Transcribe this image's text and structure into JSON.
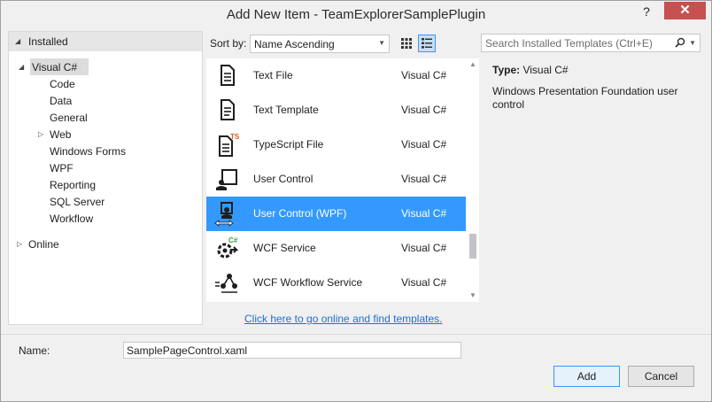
{
  "window": {
    "title": "Add New Item - TeamExplorerSamplePlugin",
    "help_glyph": "?",
    "close_glyph": "✕"
  },
  "sidebar": {
    "installed_label": "Installed",
    "visual_csharp_label": "Visual C#",
    "items": [
      {
        "label": "Code"
      },
      {
        "label": "Data"
      },
      {
        "label": "General"
      },
      {
        "label": "Web"
      },
      {
        "label": "Windows Forms"
      },
      {
        "label": "WPF"
      },
      {
        "label": "Reporting"
      },
      {
        "label": "SQL Server"
      },
      {
        "label": "Workflow"
      }
    ],
    "online_label": "Online"
  },
  "toolbar": {
    "sort_label": "Sort by:",
    "sort_value": "Name Ascending",
    "search_placeholder": "Search Installed Templates (Ctrl+E)"
  },
  "templates": [
    {
      "name": "Text File",
      "language": "Visual C#",
      "icon": "text-file-icon"
    },
    {
      "name": "Text Template",
      "language": "Visual C#",
      "icon": "text-template-icon"
    },
    {
      "name": "TypeScript File",
      "language": "Visual C#",
      "icon": "typescript-file-icon"
    },
    {
      "name": "User Control",
      "language": "Visual C#",
      "icon": "user-control-icon"
    },
    {
      "name": "User Control (WPF)",
      "language": "Visual C#",
      "icon": "user-control-wpf-icon",
      "selected": true
    },
    {
      "name": "WCF Service",
      "language": "Visual C#",
      "icon": "wcf-service-icon"
    },
    {
      "name": "WCF Workflow Service",
      "language": "Visual C#",
      "icon": "wcf-workflow-service-icon"
    }
  ],
  "online_link": "Click here to go online and find templates.",
  "details": {
    "type_label": "Type:",
    "type_value": "Visual C#",
    "description": "Windows Presentation Foundation user control"
  },
  "footer": {
    "name_label": "Name:",
    "name_value": "SamplePageControl.xaml",
    "add_label": "Add",
    "cancel_label": "Cancel"
  },
  "colors": {
    "selection": "#3399ff",
    "link": "#1e6ed6",
    "close": "#c75050"
  }
}
